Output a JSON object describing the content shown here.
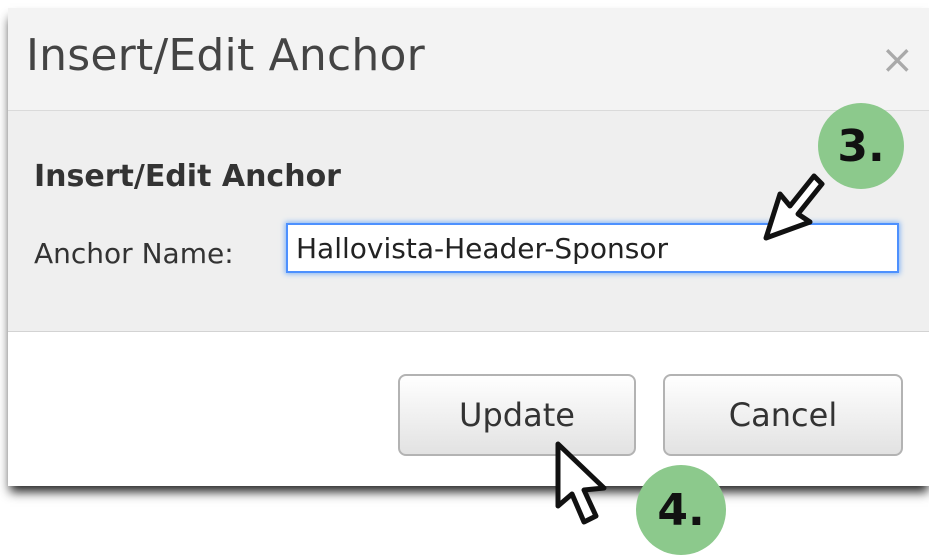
{
  "dialog": {
    "title": "Insert/Edit Anchor",
    "close_glyph": "×",
    "close_icon": "close-icon"
  },
  "form": {
    "heading": "Insert/Edit Anchor",
    "anchor_label": "Anchor Name:",
    "anchor_value": "Hallovista-Header-Sponsor"
  },
  "buttons": {
    "update": "Update",
    "cancel": "Cancel"
  },
  "annotations": {
    "step3": "3.",
    "step4": "4.",
    "badge_color": "#8cc98c",
    "pointer_icon": "mouse-pointer-icon"
  },
  "colors": {
    "focus_border": "#4d90fe",
    "titlebar_bg": "#f3f3f3",
    "body_bg": "#efefef"
  }
}
